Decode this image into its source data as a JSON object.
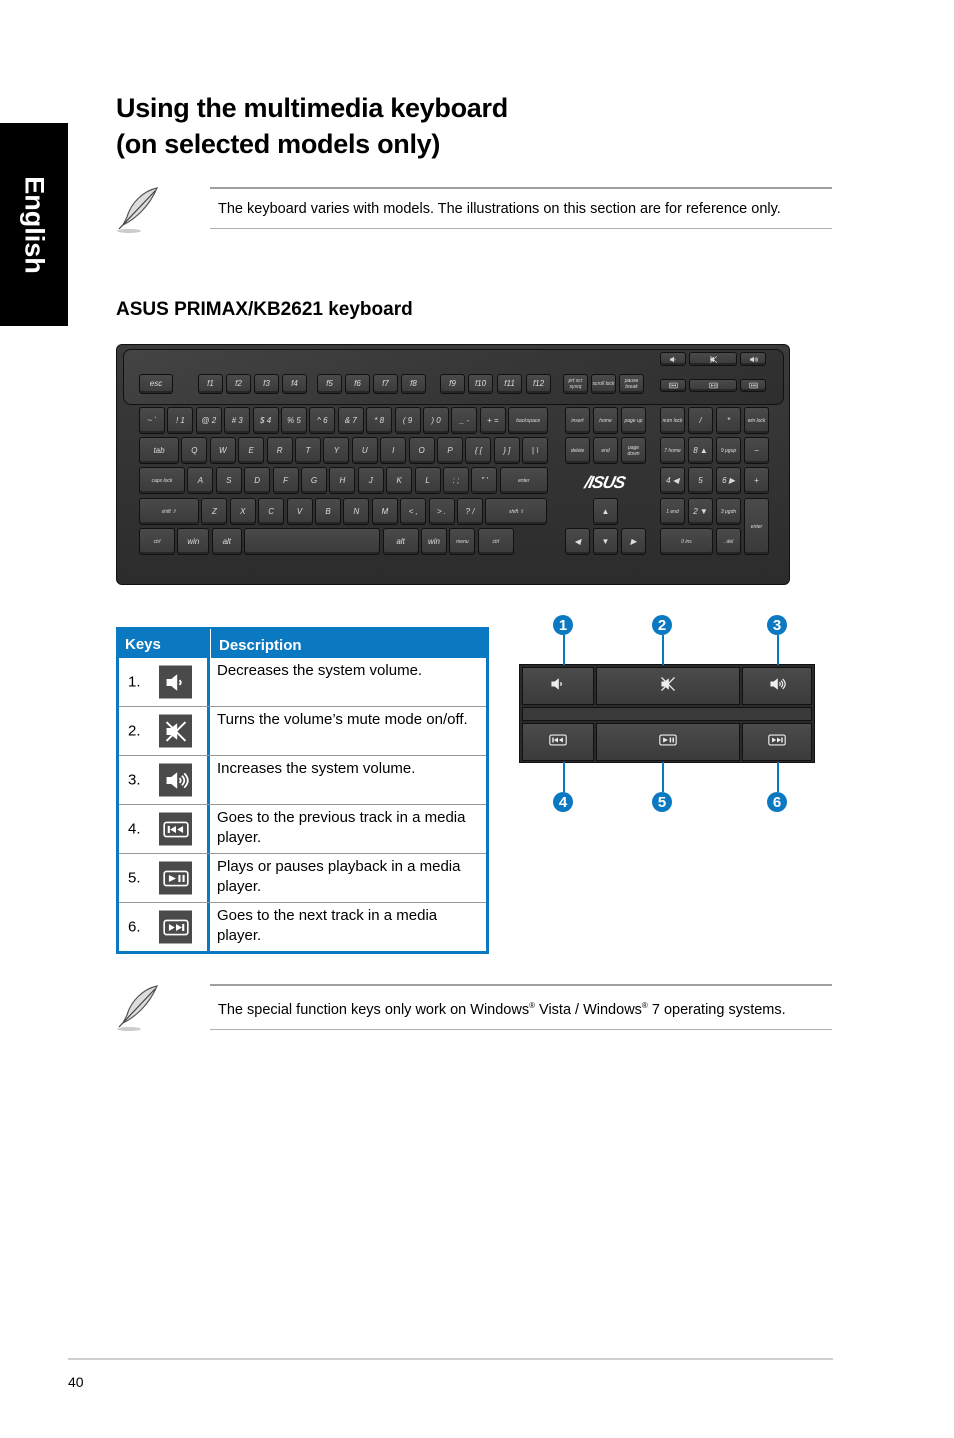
{
  "side_tab": {
    "label": "English"
  },
  "page": {
    "title_line1": "Using the multimedia keyboard",
    "title_line2": "(on selected models only)",
    "note1": "The keyboard varies with models. The illustrations on this section are for reference only.",
    "subtitle": "ASUS PRIMAX/KB2621 keyboard",
    "note2_part1": "The special function keys only work on Windows",
    "note2_reg": "®",
    "note2_part2": " Vista / Windows",
    "note2_part3": " 7 operating systems.",
    "page_number": "40"
  },
  "keyboard": {
    "brand": "/ISUS",
    "fn_row": [
      "esc",
      "f1",
      "f2",
      "f3",
      "f4",
      "f5",
      "f6",
      "f7",
      "f8",
      "f9",
      "f10",
      "f11",
      "f12"
    ],
    "sys_keys": [
      "prt scr sysrq",
      "scroll lock",
      "pause break"
    ],
    "media_keys": [
      "volume-down",
      "mute",
      "volume-up",
      "previous-track",
      "play-pause",
      "next-track"
    ],
    "row1": [
      "~ `",
      "! 1",
      "@ 2",
      "# 3",
      "$ 4",
      "% 5",
      "^ 6",
      "& 7",
      "* 8",
      "( 9",
      ") 0",
      "_ -",
      "+ =",
      "backspace"
    ],
    "row2": [
      "tab",
      "Q",
      "W",
      "E",
      "R",
      "T",
      "Y",
      "U",
      "I",
      "O",
      "P",
      "{ [",
      "} ]",
      "| \\"
    ],
    "row3": [
      "caps lock",
      "A",
      "S",
      "D",
      "F",
      "G",
      "H",
      "J",
      "K",
      "L",
      ": ;",
      "\" '",
      "enter"
    ],
    "row4": [
      "shift ⇧",
      "Z",
      "X",
      "C",
      "V",
      "B",
      "N",
      "M",
      "< ,",
      "> .",
      "? /",
      "shift ⇧"
    ],
    "row5": [
      "ctrl",
      "win",
      "alt",
      "",
      "alt",
      "win",
      "menu",
      "ctrl"
    ],
    "nav": [
      "insert",
      "home",
      "page up",
      "delete",
      "end",
      "page down"
    ],
    "arrows": [
      "▲",
      "◀",
      "▼",
      "▶"
    ],
    "numpad": [
      "num lock",
      "/",
      "*",
      "win lock",
      "7 home",
      "8 ▲",
      "9 pgup",
      "−",
      "4 ◀",
      "5",
      "6 ▶",
      "+",
      "1 end",
      "2 ▼",
      "3 pgdn",
      "enter",
      "0 ins",
      ". del"
    ]
  },
  "table": {
    "headers": {
      "keys": "Keys",
      "description": "Description"
    },
    "rows": [
      {
        "num": "1.",
        "icon": "volume-down-icon",
        "desc": "Decreases the system volume."
      },
      {
        "num": "2.",
        "icon": "mute-icon",
        "desc": "Turns the volume’s mute mode on/off."
      },
      {
        "num": "3.",
        "icon": "volume-up-icon",
        "desc": "Increases the system volume."
      },
      {
        "num": "4.",
        "icon": "previous-track-icon",
        "desc": "Goes to the previous track in a media player."
      },
      {
        "num": "5.",
        "icon": "play-pause-icon",
        "desc": "Plays or pauses playback in a media player."
      },
      {
        "num": "6.",
        "icon": "next-track-icon",
        "desc": "Goes to the next track in a media player."
      }
    ]
  },
  "callouts": [
    "1",
    "2",
    "3",
    "4",
    "5",
    "6"
  ],
  "colors": {
    "accent": "#0b79c1",
    "keyboard": "#333333"
  }
}
